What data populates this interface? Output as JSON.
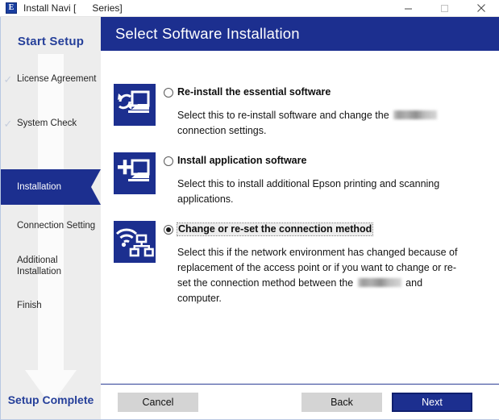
{
  "window": {
    "title": "Install Navi [      Series]",
    "app_icon": "epson-e-icon",
    "minimize_label": "minimize-icon",
    "maximize_label": "maximize-icon",
    "close_label": "close-icon"
  },
  "sidebar": {
    "title": "Start Setup",
    "footer": "Setup Complete",
    "items": [
      {
        "label": "License Agreement",
        "state": "done",
        "check": "✓"
      },
      {
        "label": "System Check",
        "state": "done",
        "check": "✓"
      },
      {
        "label": "Installation",
        "state": "active",
        "check": ""
      },
      {
        "label": "Connection Setting",
        "state": "upcoming",
        "check": ""
      },
      {
        "label": "Additional\nInstallation",
        "state": "upcoming",
        "check": ""
      },
      {
        "label": "Finish",
        "state": "upcoming",
        "check": ""
      }
    ]
  },
  "header": {
    "title": "Select Software Installation"
  },
  "options": [
    {
      "icon": "reinstall-software-icon",
      "title": "Re-install the essential software",
      "desc_part1": "Select this to re-install software and change the ",
      "desc_redacted": true,
      "desc_part2": "connection settings.",
      "selected": false,
      "focused": false
    },
    {
      "icon": "add-application-icon",
      "title": "Install application software",
      "desc_part1": "Select this to install additional Epson printing and scanning applications.",
      "desc_redacted": false,
      "desc_part2": "",
      "selected": false,
      "focused": false
    },
    {
      "icon": "network-connection-icon",
      "title": "Change or re-set the connection method",
      "desc_part1": "Select this if the network environment has changed because of replacement of the access point or if you want to change or re-set the connection method between the ",
      "desc_redacted": true,
      "desc_part2": "and computer.",
      "selected": true,
      "focused": true
    }
  ],
  "footer": {
    "cancel_label": "Cancel",
    "back_label": "Back",
    "next_label": "Next"
  },
  "colors": {
    "brand_blue": "#1c2f8f",
    "sidebar_bg": "#ededed",
    "button_gray": "#d4d4d4",
    "accent_text": "#26409a"
  }
}
